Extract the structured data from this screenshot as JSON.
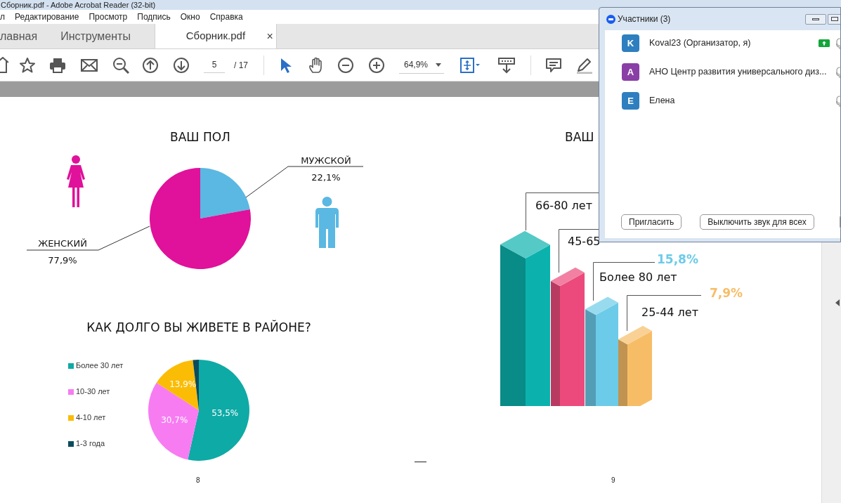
{
  "window": {
    "title": "Сборник.pdf - Adobe Acrobat Reader (32-bit)"
  },
  "menu": [
    "л",
    "Редактирование",
    "Просмотр",
    "Подпись",
    "Окно",
    "Справка"
  ],
  "tabs": [
    {
      "label": "лавная",
      "selected": false
    },
    {
      "label": "Инструменты",
      "selected": false
    },
    {
      "label": "Сборник.pdf",
      "selected": true,
      "close": "×"
    }
  ],
  "toolbar": {
    "page": "5",
    "page_count": "/ 17",
    "zoom": "64,9%"
  },
  "document": {
    "gender": {
      "chart_data": {
        "type": "pie",
        "title": "ВАШ ПОЛ",
        "categories": [
          "МУЖСКОЙ",
          "ЖЕНСКИЙ"
        ],
        "values": [
          22.1,
          77.9
        ],
        "colors": [
          "#5ab8e2",
          "#e0119a"
        ],
        "value_labels": [
          "22,1%",
          "77,9%"
        ]
      }
    },
    "residence": {
      "chart_data": {
        "type": "pie",
        "title": "КАК ДОЛГО ВЫ ЖИВЕТЕ В РАЙОНЕ?",
        "categories": [
          "Более 30 лет",
          "10-30 лет",
          "4-10 лет",
          "1-3 года"
        ],
        "values": [
          53.5,
          30.7,
          13.9,
          1.9
        ],
        "colors": [
          "#0eaaa6",
          "#f77cf2",
          "#fbbc05",
          "#0b4c5c"
        ],
        "value_labels": [
          "53,5%",
          "30,7%",
          "13,9%",
          null
        ]
      }
    },
    "age": {
      "title": "ВАШ",
      "bars": [
        {
          "label": "66-80 лет",
          "color": "#0bb2ad"
        },
        {
          "label": "45-65",
          "color": "#ec4a7c"
        },
        {
          "label": "Более 80 лет",
          "value": "15,8%",
          "color": "#6ccbe8"
        },
        {
          "label": "25-44 лет",
          "value": "7,9%",
          "color": "#f7bd66"
        }
      ]
    },
    "page_numbers": [
      "8",
      "9"
    ]
  },
  "participants": {
    "title": "Участники (3)",
    "people": [
      {
        "initial": "K",
        "name": "Koval23 (Организатор, я)",
        "color": "#2e7fbf",
        "sharing": true
      },
      {
        "initial": "А",
        "name": "АНО Центр развития универсального диз...",
        "color": "#8a3fa6",
        "sharing": false
      },
      {
        "initial": "Е",
        "name": "Елена",
        "color": "#2e7fbf",
        "sharing": false
      }
    ],
    "buttons": [
      "Пригласить",
      "Выключить звук для всех"
    ]
  }
}
